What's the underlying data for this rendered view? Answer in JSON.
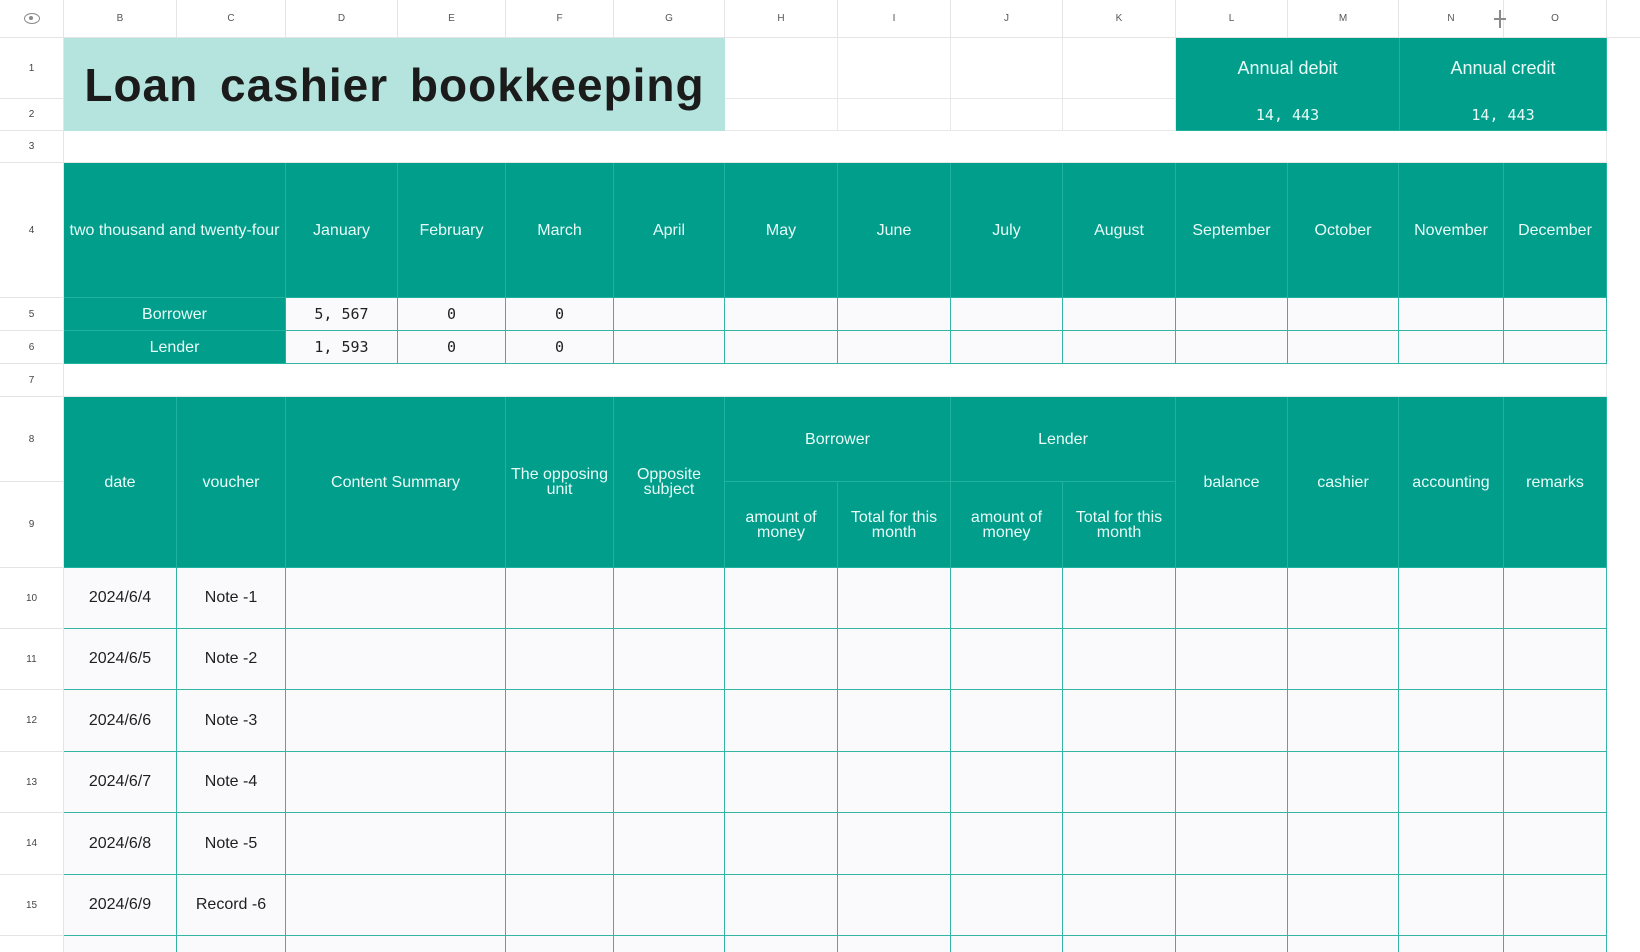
{
  "sheet": {
    "column_headers": [
      "B",
      "C",
      "D",
      "E",
      "F",
      "G",
      "H",
      "I",
      "J",
      "K",
      "L",
      "M",
      "N",
      "O"
    ],
    "row_numbers": [
      "1",
      "2",
      "3",
      "4",
      "5",
      "6",
      "7",
      "8",
      "9",
      "10",
      "11",
      "12",
      "13",
      "14",
      "15"
    ],
    "title": "Loan  cashier  bookkeeping",
    "annual_debit_label": "Annual debit",
    "annual_debit_value": "14, 443",
    "annual_credit_label": "Annual credit",
    "annual_credit_value": "14, 443"
  },
  "monthly": {
    "year_label": "two thousand and twenty-four",
    "months": [
      "January",
      "February",
      "March",
      "April",
      "May",
      "June",
      "July",
      "August",
      "September",
      "October",
      "November",
      "December"
    ],
    "borrower_label": "Borrower",
    "lender_label": "Lender",
    "borrower_values": [
      "5, 567",
      "0",
      "0"
    ],
    "lender_values": [
      "1, 593",
      "0",
      "0"
    ]
  },
  "ledger": {
    "headers": {
      "date": "date",
      "voucher": "voucher",
      "summary": "Content Summary",
      "opposing_unit": "The opposing unit",
      "opposite_subject": "Opposite subject",
      "borrower": "Borrower",
      "lender": "Lender",
      "amount": "amount of money",
      "total_month": "Total for this month",
      "balance": "balance",
      "cashier": "cashier",
      "accounting": "accounting",
      "remarks": "remarks"
    },
    "rows": [
      {
        "date": "2024/6/4",
        "voucher": "Note -1"
      },
      {
        "date": "2024/6/5",
        "voucher": "Note -2"
      },
      {
        "date": "2024/6/6",
        "voucher": "Note -3"
      },
      {
        "date": "2024/6/7",
        "voucher": "Note -4"
      },
      {
        "date": "2024/6/8",
        "voucher": "Note -5"
      },
      {
        "date": "2024/6/9",
        "voucher": "Record -6"
      }
    ]
  }
}
